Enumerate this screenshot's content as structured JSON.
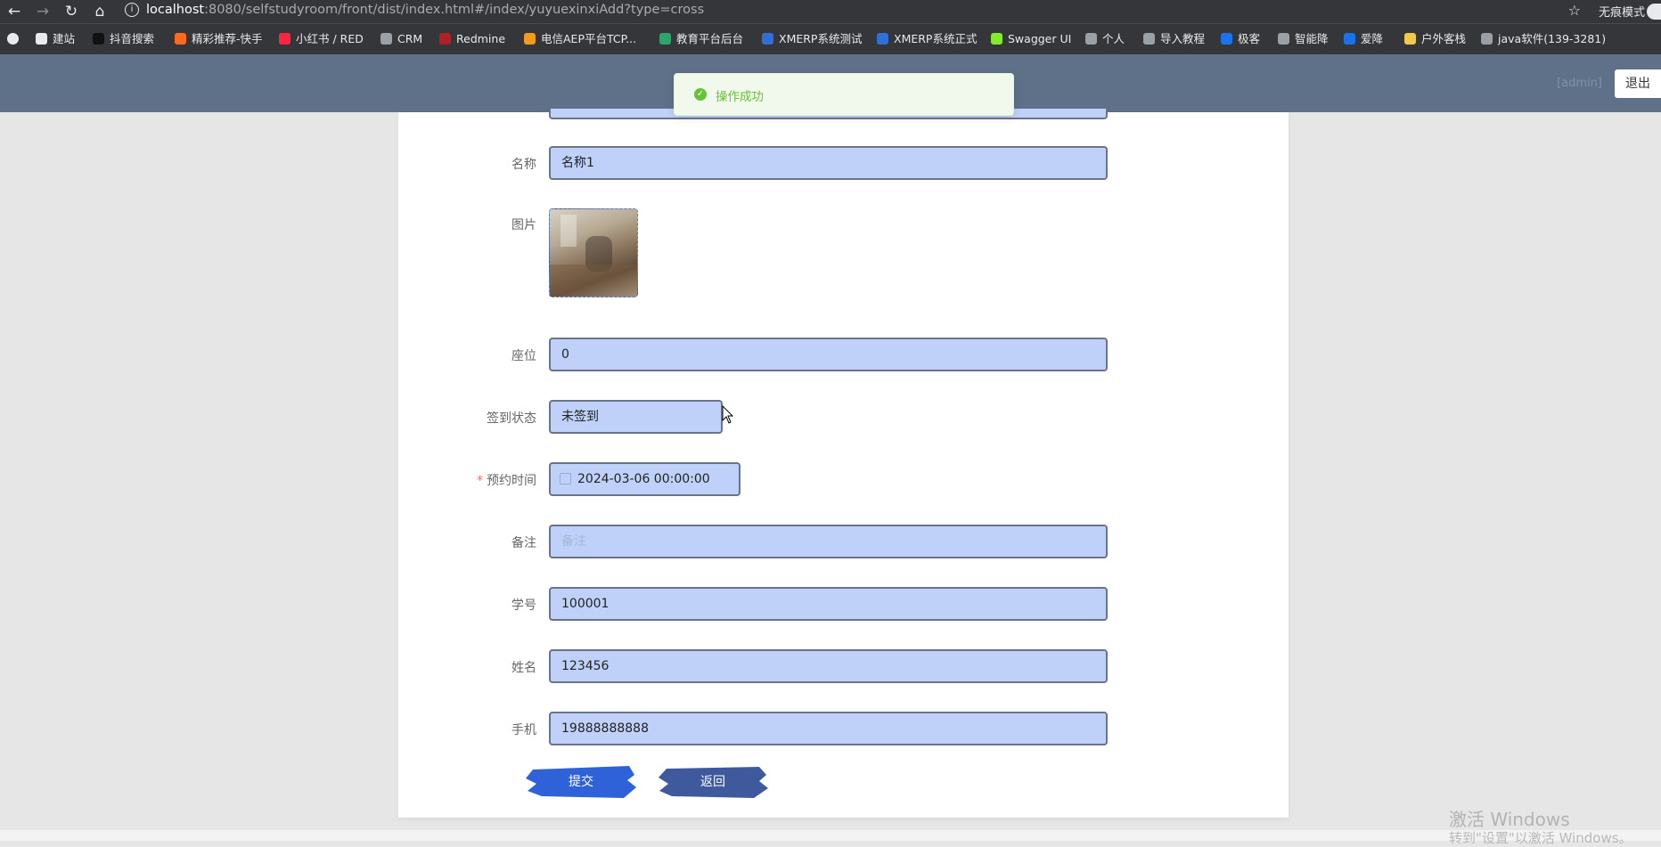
{
  "browser": {
    "url_host": "localhost",
    "url_rest": ":8080/selfstudyroom/front/dist/index.html#/index/yuyuexinxiAdd?type=cross",
    "mode_label": "无痕模式",
    "bookmarks": [
      {
        "label": "建站",
        "color": "#e8eaed"
      },
      {
        "label": "抖音搜索",
        "color": "#111111"
      },
      {
        "label": "精彩推荐-快手",
        "color": "#ff6a1f"
      },
      {
        "label": "小红书 / RED",
        "color": "#ff2442"
      },
      {
        "label": "CRM",
        "color": "#9aa0a6"
      },
      {
        "label": "Redmine",
        "color": "#b32024"
      },
      {
        "label": "电信AEP平台TCP...",
        "color": "#f29c1f"
      },
      {
        "label": "教育平台后台",
        "color": "#2fa36b"
      },
      {
        "label": "XMERP系统测试",
        "color": "#2f6fd6"
      },
      {
        "label": "XMERP系统正式",
        "color": "#2f6fd6"
      },
      {
        "label": "Swagger UI",
        "color": "#85ea2d"
      },
      {
        "label": "个人",
        "color": "#9aa0a6"
      },
      {
        "label": "导入教程",
        "color": "#9aa0a6"
      },
      {
        "label": "极客",
        "color": "#1a73e8"
      },
      {
        "label": "智能降",
        "color": "#9aa0a6"
      },
      {
        "label": "爱降",
        "color": "#1a73e8"
      },
      {
        "label": "户外客栈",
        "color": "#f2c94c"
      },
      {
        "label": "java软件(139-3281)",
        "color": "#9aa0a6"
      }
    ]
  },
  "header": {
    "user": "[admin]",
    "logout": "退出"
  },
  "toast": {
    "message": "操作成功",
    "color": "#67c23a"
  },
  "form": {
    "name": {
      "label": "名称",
      "value": "名称1"
    },
    "image": {
      "label": "图片"
    },
    "seat": {
      "label": "座位",
      "value": "0"
    },
    "checkin": {
      "label": "签到状态",
      "value": "未签到"
    },
    "time": {
      "required_mark": "*",
      "label": "预约时间",
      "value": "2024-03-06 00:00:00"
    },
    "remark": {
      "label": "备注",
      "placeholder": "备注"
    },
    "student_no": {
      "label": "学号",
      "value": "100001"
    },
    "student_name": {
      "label": "姓名",
      "value": "123456"
    },
    "phone": {
      "label": "手机",
      "value": "19888888888"
    },
    "submit": "提交",
    "back": "返回"
  },
  "windows": {
    "line1": "激活 Windows",
    "line2": "转到\"设置\"以激活 Windows。"
  }
}
